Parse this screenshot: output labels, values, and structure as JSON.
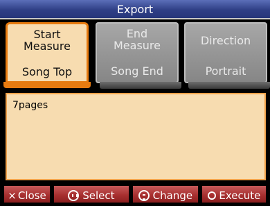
{
  "window": {
    "title": "Export"
  },
  "tabs": [
    {
      "title_line1": "Start",
      "title_line2": "Measure",
      "value": "Song Top",
      "state": "active"
    },
    {
      "title_line1": "End",
      "title_line2": "Measure",
      "value": "Song End",
      "state": "inactive"
    },
    {
      "title_line1": "Direction",
      "title_line2": "",
      "value": "Portrait",
      "state": "inactive"
    }
  ],
  "message": {
    "text": "7pages"
  },
  "footer": {
    "close_label": "Close",
    "select_label": "Select",
    "change_label": "Change",
    "execute_label": "Execute",
    "close_icon": "×"
  },
  "colors": {
    "title_bar": "#2f3f86",
    "active_tab_fill": "#f7dcb0",
    "active_tab_border": "#e77b10",
    "inactive_tab_fill": "#969696",
    "footer_button": "#a83030"
  },
  "icons": {
    "close": "close-icon",
    "select": "left-right-dial-icon",
    "change": "up-down-dial-icon",
    "execute": "circle-icon"
  }
}
